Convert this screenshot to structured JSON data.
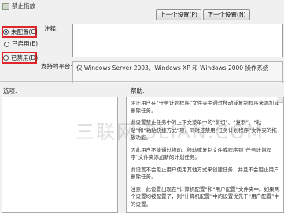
{
  "window": {
    "title": "禁止拖放"
  },
  "nav": {
    "prev": "上一个设置(P)",
    "next": "下一个设置(N)"
  },
  "state": {
    "options": [
      {
        "label": "未配置(C)",
        "selected": true
      },
      {
        "label": "已启用(E)",
        "selected": false
      },
      {
        "label": "已禁用(D)",
        "selected": false
      }
    ]
  },
  "comment": {
    "label": "注释:",
    "value": ""
  },
  "supported": {
    "label": "支持的平台:",
    "value": "仅 Windows Server 2003、Windows XP 和 Windows 2000 操作系统"
  },
  "options_section": {
    "label": "选项:"
  },
  "help": {
    "label": "帮助:",
    "paragraphs": [
      "阻止用户在“任务计划程序”文件夹中通过移动或复制程序来添加或删除任务。",
      "此设置禁止任务中的上下文菜单中的“剪切”、“复制”、“粘贴”和“粘贴快捷方式”项。同时还禁用“任务计划程序”文件夹的拖放功能。",
      "因此用户不能通过拖动、移动或复制文件或程序到“任务计划程序”文件夹添加新的计划任务。",
      "此设置不会阻止用户使用其他方式来创建任务，并且不会阻止用户删除任务。",
      "注意：此设置出现在“计算机配置”和“用户配置”文件夹中。如果两个设置均被配置了，则“计算机配置”中的设置优先于“用户配置”中的设置。"
    ]
  },
  "watermark": {
    "text": "三联网 3LIAN.COM"
  },
  "colors": {
    "highlight": "#e0262a",
    "radio_dot": "#1b4a7a"
  }
}
